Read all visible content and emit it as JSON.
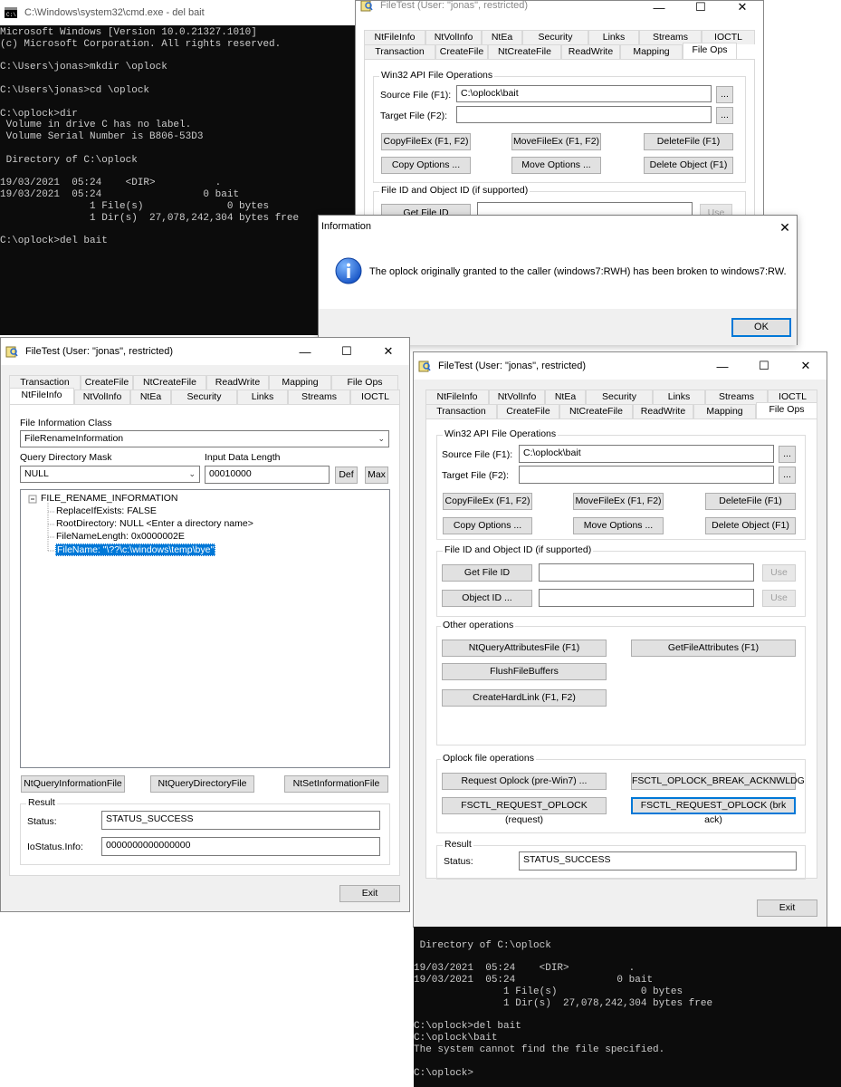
{
  "cmd_top": {
    "title": "C:\\Windows\\system32\\cmd.exe - del  bait",
    "lines": [
      "Microsoft Windows [Version 10.0.21327.1010]",
      "(c) Microsoft Corporation. All rights reserved.",
      "",
      "C:\\Users\\jonas>mkdir \\oplock",
      "",
      "C:\\Users\\jonas>cd \\oplock",
      "",
      "C:\\oplock>dir",
      " Volume in drive C has no label.",
      " Volume Serial Number is B806-53D3",
      "",
      " Directory of C:\\oplock",
      "",
      "19/03/2021  05:24    <DIR>          .",
      "19/03/2021  05:24                 0 bait",
      "               1 File(s)              0 bytes",
      "               1 Dir(s)  27,078,242,304 bytes free",
      "",
      "C:\\oplock>del bait"
    ]
  },
  "cmd_bottom": {
    "lines": [
      "",
      " Directory of C:\\oplock",
      "",
      "19/03/2021  05:24    <DIR>          .",
      "19/03/2021  05:24                 0 bait",
      "               1 File(s)              0 bytes",
      "               1 Dir(s)  27,078,242,304 bytes free",
      "",
      "C:\\oplock>del bait",
      "C:\\oplock\\bait",
      "The system cannot find the file specified.",
      "",
      "C:\\oplock>"
    ]
  },
  "ft_top": {
    "title": "FileTest (User: \"jonas\", restricted)",
    "tabs_row1": [
      "NtFileInfo",
      "NtVolInfo",
      "NtEa",
      "Security",
      "Links",
      "Streams",
      "IOCTL"
    ],
    "tabs_row2": [
      "Transaction",
      "CreateFile",
      "NtCreateFile",
      "ReadWrite",
      "Mapping",
      "File Ops"
    ],
    "group_win32": "Win32 API File Operations",
    "source_label": "Source File (F1):",
    "source_value": "C:\\oplock\\bait",
    "target_label": "Target File (F2):",
    "target_value": "",
    "browse": "...",
    "btn_copy": "CopyFileEx (F1, F2)",
    "btn_move": "MoveFileEx (F1, F2)",
    "btn_delete": "DeleteFile (F1)",
    "btn_copy_opts": "Copy Options ...",
    "btn_move_opts": "Move Options ...",
    "btn_delete_obj": "Delete Object (F1)",
    "group_fileid": "File ID and Object ID (if supported)",
    "btn_get_file_id": "Get File ID",
    "btn_use": "Use"
  },
  "info_dialog": {
    "title": "Information",
    "message": "The oplock originally granted to the caller (windows7:RWH) has been broken to windows7:RW.",
    "ok": "OK",
    "accent": "#0078d7"
  },
  "ft_left": {
    "title": "FileTest (User: \"jonas\", restricted)",
    "tabs_row1": [
      "Transaction",
      "CreateFile",
      "NtCreateFile",
      "ReadWrite",
      "Mapping",
      "File Ops"
    ],
    "tabs_row2": [
      "NtFileInfo",
      "NtVolInfo",
      "NtEa",
      "Security",
      "Links",
      "Streams",
      "IOCTL"
    ],
    "info_class_label": "File Information Class",
    "info_class_value": "FileRenameInformation",
    "query_mask_label": "Query Directory Mask",
    "query_mask_value": "NULL",
    "input_len_label": "Input Data Length",
    "input_len_value": "00010000",
    "btn_def": "Def",
    "btn_max": "Max",
    "tree_root": "FILE_RENAME_INFORMATION",
    "tree_children": [
      "ReplaceIfExists: FALSE",
      "RootDirectory: NULL <Enter a directory name>",
      "FileNameLength: 0x0000002E",
      "FileName: \"\\??\\c:\\windows\\temp\\bye\""
    ],
    "btn_query_info": "NtQueryInformationFile",
    "btn_query_dir": "NtQueryDirectoryFile",
    "btn_set_info": "NtSetInformationFile",
    "result_label": "Result",
    "status_label": "Status:",
    "status_value": "STATUS_SUCCESS",
    "iostatus_label": "IoStatus.Info:",
    "iostatus_value": "0000000000000000",
    "btn_exit": "Exit"
  },
  "ft_right": {
    "title": "FileTest (User: \"jonas\", restricted)",
    "tabs_row1": [
      "NtFileInfo",
      "NtVolInfo",
      "NtEa",
      "Security",
      "Links",
      "Streams",
      "IOCTL"
    ],
    "tabs_row2": [
      "Transaction",
      "CreateFile",
      "NtCreateFile",
      "ReadWrite",
      "Mapping",
      "File Ops"
    ],
    "group_win32": "Win32 API File Operations",
    "source_label": "Source File (F1):",
    "source_value": "C:\\oplock\\bait",
    "target_label": "Target File (F2):",
    "target_value": "",
    "browse": "...",
    "btn_copy": "CopyFileEx (F1, F2)",
    "btn_move": "MoveFileEx (F1, F2)",
    "btn_delete": "DeleteFile (F1)",
    "btn_copy_opts": "Copy Options ...",
    "btn_move_opts": "Move Options ...",
    "btn_delete_obj": "Delete Object (F1)",
    "group_fileid": "File ID and Object ID (if supported)",
    "btn_get_file_id": "Get File ID",
    "btn_object_id": "Object ID ...",
    "btn_use": "Use",
    "group_other": "Other operations",
    "btn_ntquery_attr": "NtQueryAttributesFile (F1)",
    "btn_get_attr": "GetFileAttributes (F1)",
    "btn_flush": "FlushFileBuffers",
    "btn_hardlink": "CreateHardLink (F1, F2)",
    "group_oplock": "Oplock file operations",
    "btn_req_oplock": "Request Oplock (pre-Win7) ...",
    "btn_break_ack": "FSCTL_OPLOCK_BREAK_ACKNWLDG",
    "btn_fsctl_req": "FSCTL_REQUEST_OPLOCK (request)",
    "btn_fsctl_brk": "FSCTL_REQUEST_OPLOCK (brk ack)",
    "result_label": "Result",
    "status_label": "Status:",
    "status_value": "STATUS_SUCCESS",
    "btn_exit": "Exit"
  }
}
